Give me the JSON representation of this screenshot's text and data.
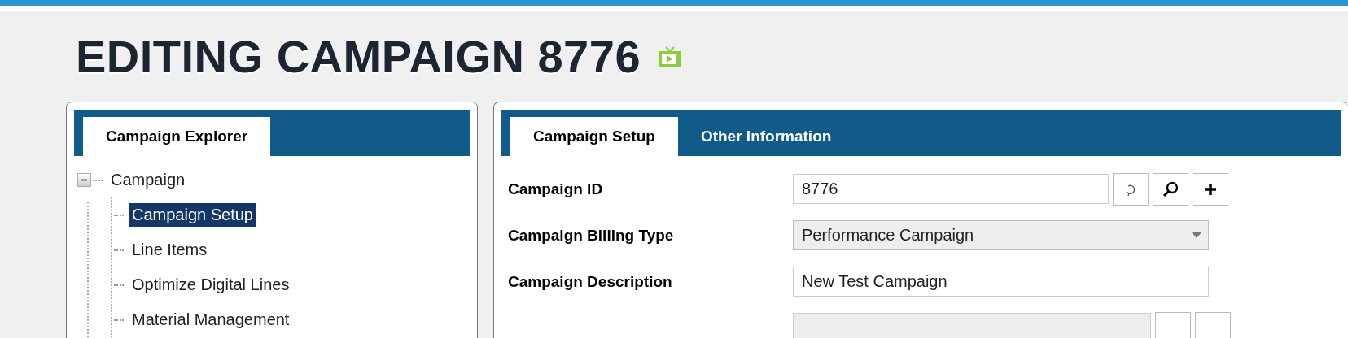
{
  "page_title": "EDITING CAMPAIGN 8776",
  "explorer": {
    "tabs": [
      {
        "label": "Campaign Explorer",
        "selected": true
      }
    ],
    "tree": [
      {
        "label": "Campaign",
        "expanded": true,
        "selected": false,
        "children": [
          {
            "label": "Campaign Setup",
            "selected": true
          },
          {
            "label": "Line Items",
            "selected": false
          },
          {
            "label": "Optimize Digital Lines",
            "selected": false
          },
          {
            "label": "Material Management",
            "selected": false
          }
        ]
      }
    ]
  },
  "editor": {
    "tabs": [
      {
        "label": "Campaign Setup",
        "selected": true
      },
      {
        "label": "Other Information",
        "selected": false
      }
    ],
    "fields": [
      {
        "kind": "lookup",
        "label": "Campaign ID",
        "value": "8776"
      },
      {
        "kind": "select",
        "label": "Campaign Billing Type",
        "value": "Performance Campaign"
      },
      {
        "kind": "text",
        "label": "Campaign Description",
        "value": "New Test Campaign"
      }
    ]
  }
}
